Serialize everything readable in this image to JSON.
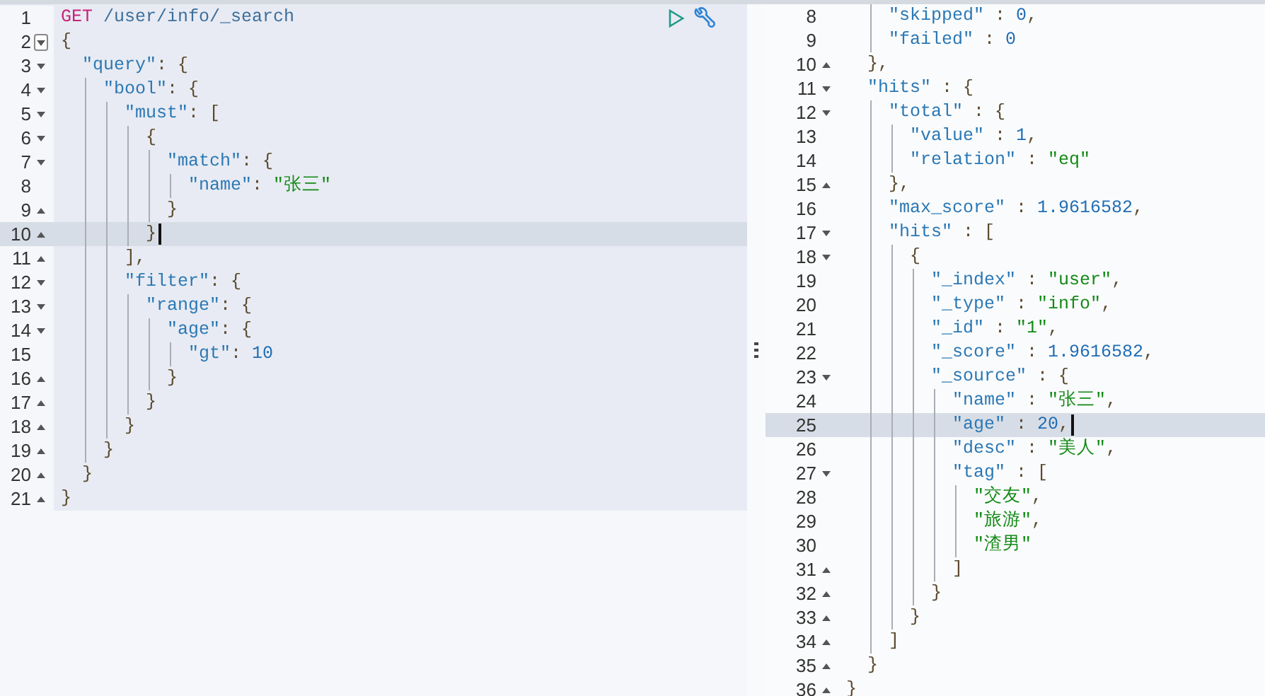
{
  "request_editor": {
    "lines": [
      {
        "number": "1",
        "kind": "plain",
        "hovered": false,
        "active": false,
        "text": "GET /user/info/_search"
      },
      {
        "number": "2",
        "kind": "block-start",
        "hovered": true,
        "active": false,
        "text": "{"
      },
      {
        "number": "3",
        "kind": "block-start",
        "hovered": false,
        "active": false,
        "text": "  \"query\": {"
      },
      {
        "number": "4",
        "kind": "block-start",
        "hovered": false,
        "active": false,
        "text": "    \"bool\": {"
      },
      {
        "number": "5",
        "kind": "block-start",
        "hovered": false,
        "active": false,
        "text": "      \"must\": ["
      },
      {
        "number": "6",
        "kind": "block-start",
        "hovered": false,
        "active": false,
        "text": "        {"
      },
      {
        "number": "7",
        "kind": "block-start",
        "hovered": false,
        "active": false,
        "text": "          \"match\": {"
      },
      {
        "number": "8",
        "kind": "plain",
        "hovered": false,
        "active": false,
        "text": "            \"name\": \"张三\""
      },
      {
        "number": "9",
        "kind": "block-end",
        "hovered": false,
        "active": false,
        "text": "          }"
      },
      {
        "number": "10",
        "kind": "block-end",
        "hovered": false,
        "active": true,
        "text": "        }"
      },
      {
        "number": "11",
        "kind": "block-end",
        "hovered": false,
        "active": false,
        "text": "      ],"
      },
      {
        "number": "12",
        "kind": "block-start",
        "hovered": false,
        "active": false,
        "text": "      \"filter\": {"
      },
      {
        "number": "13",
        "kind": "block-start",
        "hovered": false,
        "active": false,
        "text": "        \"range\": {"
      },
      {
        "number": "14",
        "kind": "block-start",
        "hovered": false,
        "active": false,
        "text": "          \"age\": {"
      },
      {
        "number": "15",
        "kind": "plain",
        "hovered": false,
        "active": false,
        "text": "            \"gt\": 10"
      },
      {
        "number": "16",
        "kind": "block-end",
        "hovered": false,
        "active": false,
        "text": "          }"
      },
      {
        "number": "17",
        "kind": "block-end",
        "hovered": false,
        "active": false,
        "text": "        }"
      },
      {
        "number": "18",
        "kind": "block-end",
        "hovered": false,
        "active": false,
        "text": "      }"
      },
      {
        "number": "19",
        "kind": "block-end",
        "hovered": false,
        "active": false,
        "text": "    }"
      },
      {
        "number": "20",
        "kind": "block-end",
        "hovered": false,
        "active": false,
        "text": "  }"
      },
      {
        "number": "21",
        "kind": "block-end",
        "hovered": false,
        "active": false,
        "text": "}"
      }
    ]
  },
  "response_viewer": {
    "lines": [
      {
        "number": "8",
        "kind": "plain",
        "hovered": false,
        "active": false,
        "text": "    \"skipped\" : 0,"
      },
      {
        "number": "9",
        "kind": "plain",
        "hovered": false,
        "active": false,
        "text": "    \"failed\" : 0"
      },
      {
        "number": "10",
        "kind": "block-end",
        "hovered": false,
        "active": false,
        "text": "  },"
      },
      {
        "number": "11",
        "kind": "block-start",
        "hovered": false,
        "active": false,
        "text": "  \"hits\" : {"
      },
      {
        "number": "12",
        "kind": "block-start",
        "hovered": false,
        "active": false,
        "text": "    \"total\" : {"
      },
      {
        "number": "13",
        "kind": "plain",
        "hovered": false,
        "active": false,
        "text": "      \"value\" : 1,"
      },
      {
        "number": "14",
        "kind": "plain",
        "hovered": false,
        "active": false,
        "text": "      \"relation\" : \"eq\""
      },
      {
        "number": "15",
        "kind": "block-end",
        "hovered": false,
        "active": false,
        "text": "    },"
      },
      {
        "number": "16",
        "kind": "plain",
        "hovered": false,
        "active": false,
        "text": "    \"max_score\" : 1.9616582,"
      },
      {
        "number": "17",
        "kind": "block-start",
        "hovered": false,
        "active": false,
        "text": "    \"hits\" : ["
      },
      {
        "number": "18",
        "kind": "block-start",
        "hovered": false,
        "active": false,
        "text": "      {"
      },
      {
        "number": "19",
        "kind": "plain",
        "hovered": false,
        "active": false,
        "text": "        \"_index\" : \"user\","
      },
      {
        "number": "20",
        "kind": "plain",
        "hovered": false,
        "active": false,
        "text": "        \"_type\" : \"info\","
      },
      {
        "number": "21",
        "kind": "plain",
        "hovered": false,
        "active": false,
        "text": "        \"_id\" : \"1\","
      },
      {
        "number": "22",
        "kind": "plain",
        "hovered": false,
        "active": false,
        "text": "        \"_score\" : 1.9616582,"
      },
      {
        "number": "23",
        "kind": "block-start",
        "hovered": false,
        "active": false,
        "text": "        \"_source\" : {"
      },
      {
        "number": "24",
        "kind": "plain",
        "hovered": false,
        "active": false,
        "text": "          \"name\" : \"张三\","
      },
      {
        "number": "25",
        "kind": "plain",
        "hovered": false,
        "active": true,
        "text": "          \"age\" : 20,"
      },
      {
        "number": "26",
        "kind": "plain",
        "hovered": false,
        "active": false,
        "text": "          \"desc\" : \"美人\","
      },
      {
        "number": "27",
        "kind": "block-start",
        "hovered": false,
        "active": false,
        "text": "          \"tag\" : ["
      },
      {
        "number": "28",
        "kind": "plain",
        "hovered": false,
        "active": false,
        "text": "            \"交友\","
      },
      {
        "number": "29",
        "kind": "plain",
        "hovered": false,
        "active": false,
        "text": "            \"旅游\","
      },
      {
        "number": "30",
        "kind": "plain",
        "hovered": false,
        "active": false,
        "text": "            \"渣男\""
      },
      {
        "number": "31",
        "kind": "block-end",
        "hovered": false,
        "active": false,
        "text": "          ]"
      },
      {
        "number": "32",
        "kind": "block-end",
        "hovered": false,
        "active": false,
        "text": "        }"
      },
      {
        "number": "33",
        "kind": "block-end",
        "hovered": false,
        "active": false,
        "text": "      }"
      },
      {
        "number": "34",
        "kind": "block-end",
        "hovered": false,
        "active": false,
        "text": "    ]"
      },
      {
        "number": "35",
        "kind": "block-end",
        "hovered": false,
        "active": false,
        "text": "  }"
      },
      {
        "number": "36",
        "kind": "block-end",
        "hovered": false,
        "active": false,
        "text": "}"
      }
    ]
  }
}
